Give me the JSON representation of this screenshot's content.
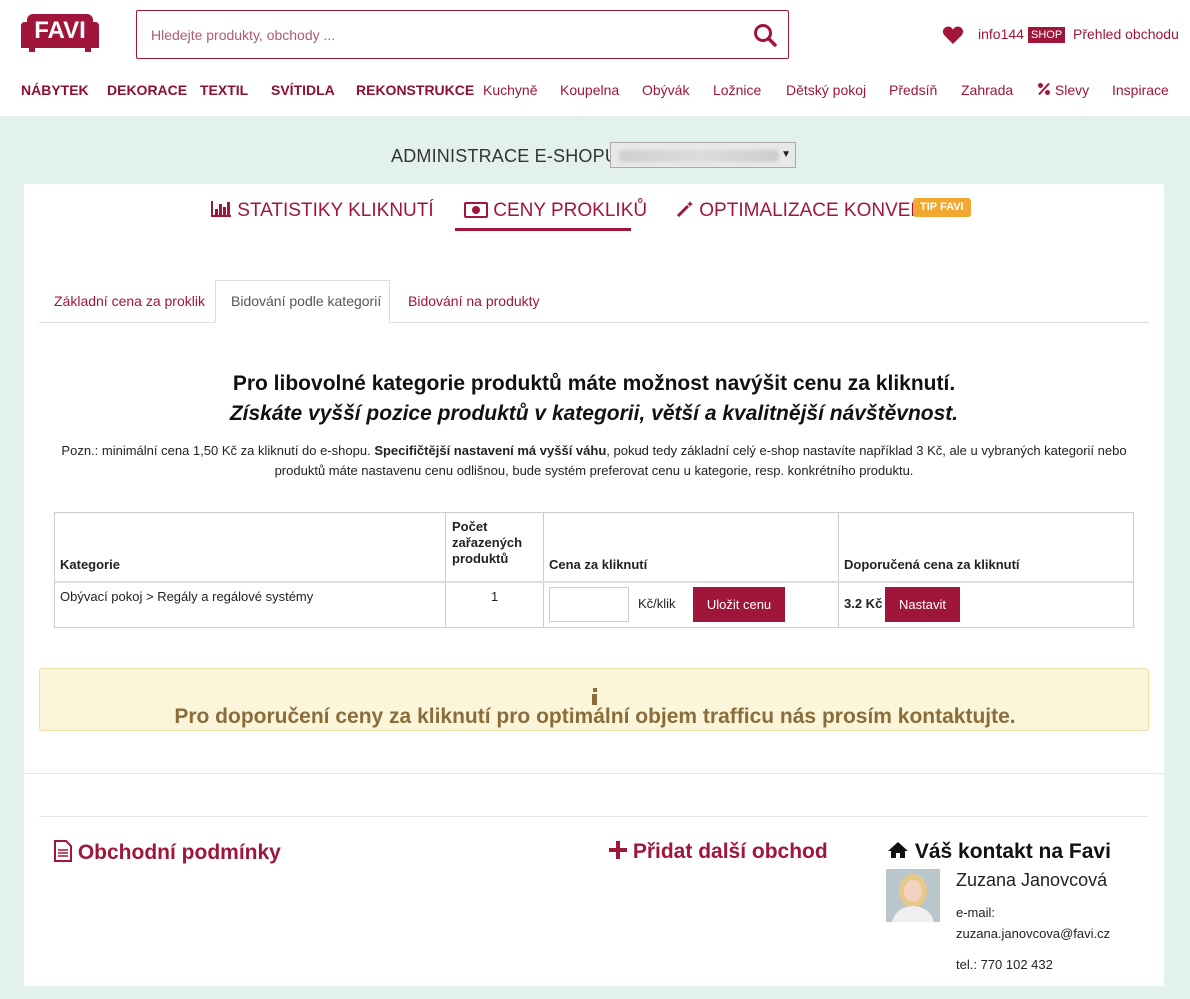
{
  "header": {
    "search_placeholder": "Hledejte produkty, obchody ...",
    "user": "info144",
    "shop_badge": "SHOP",
    "overview": "Přehled obchodu"
  },
  "nav": [
    "NÁBYTEK",
    "DEKORACE",
    "TEXTIL",
    "SVÍTIDLA",
    "REKONSTRUKCE",
    "Kuchyně",
    "Koupelna",
    "Obývák",
    "Ložnice",
    "Dětský pokoj",
    "Předsíň",
    "Zahrada",
    "Slevy",
    "Inspirace"
  ],
  "admin": {
    "label": "ADMINISTRACE E-SHOPU"
  },
  "top_tabs": {
    "stats": "STATISTIKY KLIKNUTÍ",
    "prices": "CENY PROKLIKŮ",
    "optimization": "OPTIMALIZACE KONVERZÍ",
    "tip": "TIP FAVI"
  },
  "sub_tabs": {
    "basic": "Základní cena za proklik",
    "categories": "Bidování podle kategorií",
    "products": "Bidování na produkty"
  },
  "headline1": "Pro libovolné kategorie produktů máte možnost navýšit cenu za kliknutí.",
  "headline2": "Získáte vyšší pozice produktů v kategorii, větší a kvalitnější návštěvnost.",
  "note": {
    "part1": "Pozn.: minimální cena 1,50 Kč za kliknutí do e-shopu. ",
    "bold": "Specifičtější nastavení má vyšší váhu",
    "part2": ", pokud tedy základní celý e-shop nastavíte například 3 Kč, ale u vybraných kategorií nebo",
    "line2": "produktů máte nastavenu cenu odlišnou, bude systém preferovat cenu u kategorie, resp. konkrétního produktu."
  },
  "table": {
    "h_category": "Kategorie",
    "h_count_1": "Počet",
    "h_count_2": "zařazených",
    "h_count_3": "produktů",
    "h_price": "Cena za kliknutí",
    "h_recommended": "Doporučená cena za kliknutí",
    "row": {
      "category": "Obývací pokoj > Regály a regálové systémy",
      "count": "1",
      "unit": "Kč/klik",
      "save": "Uložit cenu",
      "recommended": "3.2 Kč",
      "set": "Nastavit"
    }
  },
  "info": "Pro doporučení ceny za kliknutí pro optimální objem trafficu nás prosím kontaktujte.",
  "footer": {
    "terms": "Obchodní podmínky",
    "add_shop": "Přidat další obchod",
    "contact_title": "Váš kontakt na Favi",
    "contact_name": "Zuzana Janovcová",
    "email_label": "e-mail:",
    "email": "zuzana.janovcova@favi.cz",
    "phone": "tel.: 770 102 432"
  },
  "colors": {
    "brand": "#a0163a",
    "page_bg": "#e3f1ec",
    "info_bg": "#fbf5d9",
    "tip": "#f0a830"
  }
}
